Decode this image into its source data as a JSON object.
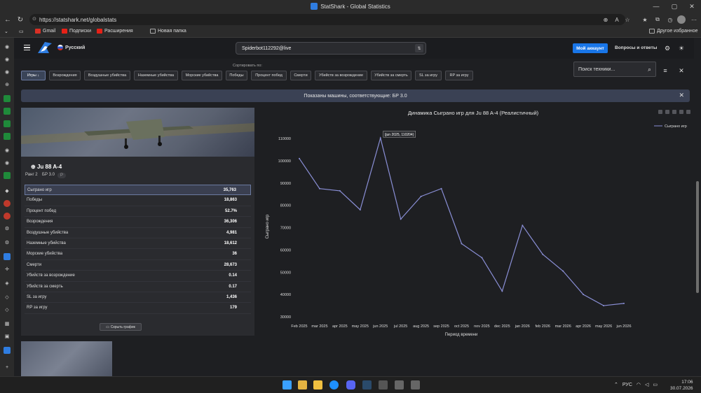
{
  "window": {
    "title": "StatShark - Global Statistics"
  },
  "browser": {
    "url": "https://statshark.net/globalstats",
    "bookmarks": [
      {
        "label": "Gmail",
        "color": "#d93025"
      },
      {
        "label": "Подписки",
        "color": "#e62117"
      },
      {
        "label": "Расширения",
        "color": "#e62117"
      },
      {
        "label": "Новая папка",
        "color": "#aaaaaa"
      }
    ],
    "other_bookmarks": "Другое избранное"
  },
  "site": {
    "language": "Русский",
    "search_value": "Spiderbot112292@live",
    "my_account": "Мой аккаунт",
    "faq": "Вопросы и ответы",
    "sort_label": "Сортировать по:",
    "sort_buttons": [
      "Игры ↓",
      "Возрождения",
      "Воздушные убийства",
      "Наземные убийства",
      "Морские убийства",
      "Победы",
      "Процент побед",
      "Смерти",
      "Убийств за возрождение",
      "Убийств за смерть",
      "SL за игру",
      "RP за игру"
    ],
    "tech_search_placeholder": "Поиск техники...",
    "banner": "Показаны машины, соответствующие: БР 3.0",
    "accent": "#1976e8"
  },
  "vehicle": {
    "name": "Ju 88 A-4",
    "rank": "Ранг 2",
    "br": "БР 3.0",
    "badge": "P",
    "stats": [
      {
        "label": "Сыграно игр",
        "value": "35,763"
      },
      {
        "label": "Победы",
        "value": "18,863"
      },
      {
        "label": "Процент побед",
        "value": "52.7%"
      },
      {
        "label": "Возрождения",
        "value": "36,306"
      },
      {
        "label": "Воздушные убийства",
        "value": "4,981"
      },
      {
        "label": "Наземные убийства",
        "value": "18,612"
      },
      {
        "label": "Морские убийства",
        "value": "36"
      },
      {
        "label": "Смерти",
        "value": "28,673"
      },
      {
        "label": "Убийств за возрождение",
        "value": "0.14"
      },
      {
        "label": "Убийств за смерть",
        "value": "0.17"
      },
      {
        "label": "SL за игру",
        "value": "1,436"
      },
      {
        "label": "RP за игру",
        "value": "179"
      }
    ],
    "hide_chart": "Скрыть график"
  },
  "chart_data": {
    "type": "line",
    "title_prefix": "Динамика Сыграно игр для",
    "title_suffix": "Ju 88 A-4 (Реалистичный)",
    "xlabel": "Период времени",
    "ylabel": "Сыграно игр",
    "legend": "Сыграно игр",
    "legend_position": "top-right",
    "tooltip": "(jun 2025, 110204)",
    "line_color": "#8a8fd6",
    "categories": [
      "Feb 2025",
      "mar 2025",
      "apr 2025",
      "may 2025",
      "jun 2025",
      "jul 2025",
      "aug 2025",
      "sep 2025",
      "oct 2025",
      "nov 2025",
      "dec 2025",
      "jan 2026",
      "feb 2026",
      "mar 2026",
      "apr 2026",
      "may 2026",
      "jun 2026"
    ],
    "values": [
      101000,
      87500,
      86500,
      78000,
      110204,
      73800,
      84000,
      87500,
      62800,
      56500,
      41500,
      71000,
      58000,
      50500,
      40000,
      35000,
      36000
    ],
    "yticks": [
      "110000",
      "100000",
      "90000",
      "80000",
      "70000",
      "60000",
      "50000",
      "40000",
      "30000"
    ],
    "ylim": [
      30000,
      110000
    ]
  },
  "taskbar": {
    "lang": "РУС",
    "time": "17:06",
    "date": "30.07.2026"
  }
}
